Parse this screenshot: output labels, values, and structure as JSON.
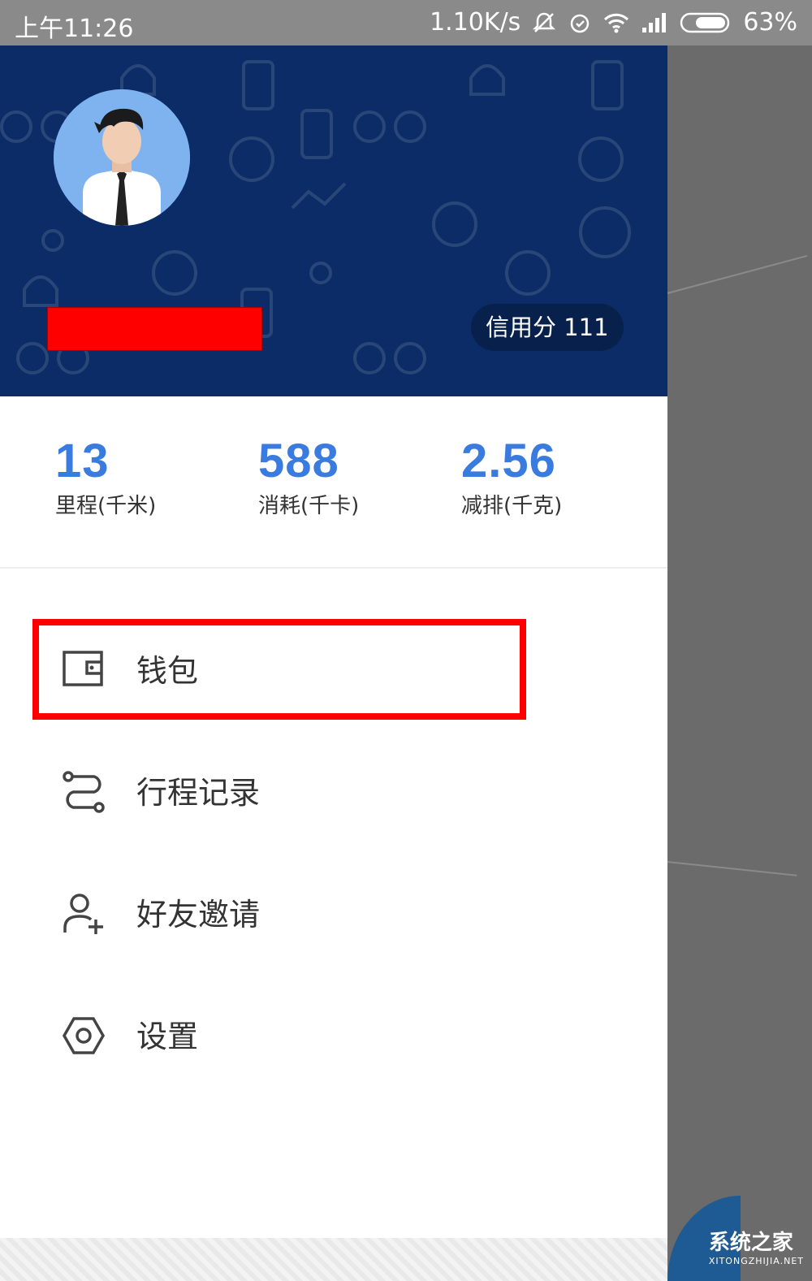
{
  "status_bar": {
    "time": "上午11:26",
    "net_speed": "1.10K/s",
    "battery": "63%"
  },
  "profile": {
    "credit_label": "信用分 111"
  },
  "stats": [
    {
      "value": "13",
      "label": "里程(千米)"
    },
    {
      "value": "588",
      "label": "消耗(千卡)"
    },
    {
      "value": "2.56",
      "label": "减排(千克)"
    }
  ],
  "menu": [
    {
      "label": "钱包",
      "icon": "wallet-icon"
    },
    {
      "label": "行程记录",
      "icon": "route-icon"
    },
    {
      "label": "好友邀请",
      "icon": "add-friend-icon"
    },
    {
      "label": "设置",
      "icon": "settings-icon"
    }
  ],
  "watermark": {
    "title": "系统之家",
    "url": "XITONGZHIJIA.NET"
  },
  "colors": {
    "header_bg": "#0b2c66",
    "stat_value": "#3a7be0",
    "highlight": "#ff0000",
    "status_bar": "#8a8a8a"
  }
}
